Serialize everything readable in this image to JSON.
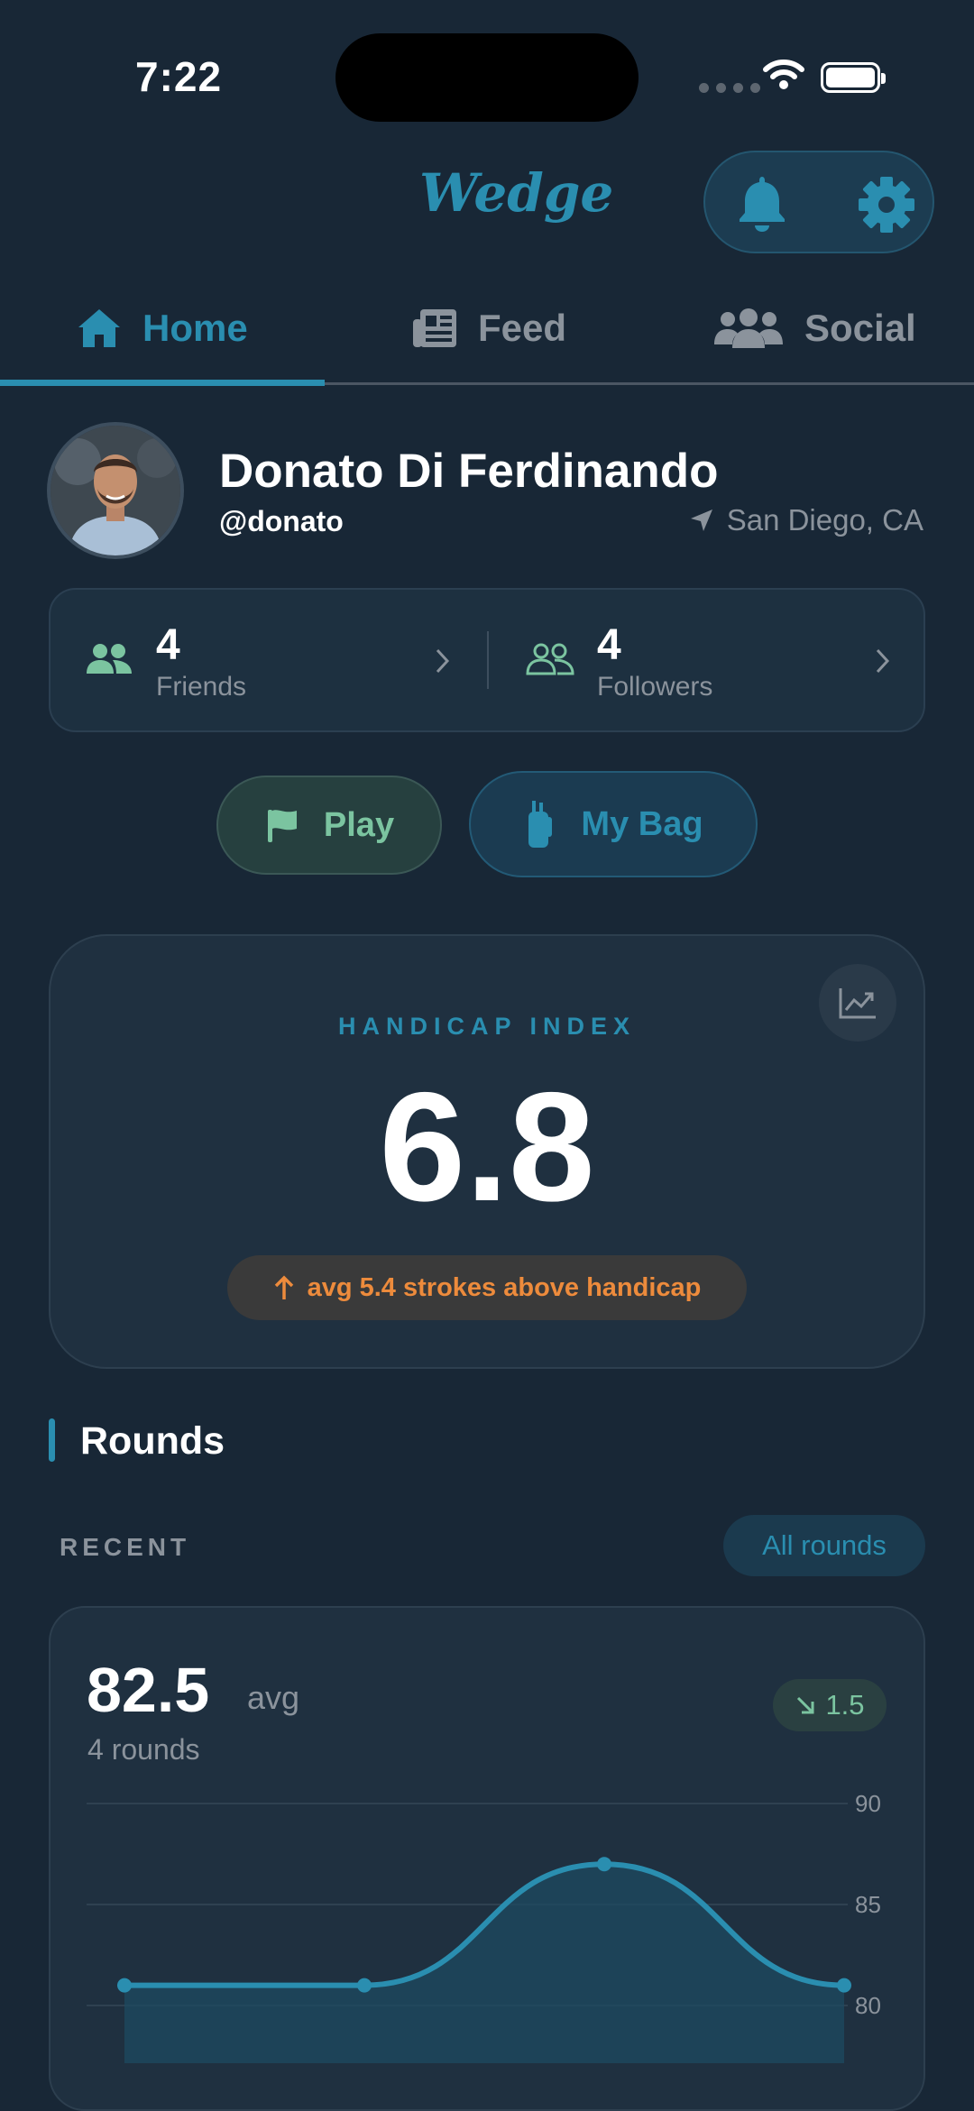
{
  "status_bar": {
    "time": "7:22"
  },
  "header": {
    "logo": "Wedge"
  },
  "tabs": [
    {
      "label": "Home",
      "active": true
    },
    {
      "label": "Feed",
      "active": false
    },
    {
      "label": "Social",
      "active": false
    }
  ],
  "profile": {
    "name": "Donato Di Ferdinando",
    "handle": "@donato",
    "location": "San Diego, CA",
    "friends": {
      "count": "4",
      "label": "Friends"
    },
    "followers": {
      "count": "4",
      "label": "Followers"
    }
  },
  "actions": {
    "play": "Play",
    "bag": "My Bag"
  },
  "handicap": {
    "label": "HANDICAP INDEX",
    "value": "6.8",
    "note": "avg 5.4 strokes above handicap"
  },
  "rounds": {
    "title": "Rounds",
    "recent_label": "RECENT",
    "all_rounds": "All rounds",
    "avg": "82.5",
    "avg_unit": "avg",
    "count_text": "4 rounds",
    "delta": "1.5"
  },
  "colors": {
    "accent": "#2a8eb0",
    "green": "#7bc4a0",
    "orange": "#ed8b3c",
    "background": "#182736"
  },
  "chart_data": {
    "type": "area",
    "x": [
      1,
      2,
      3,
      4
    ],
    "values": [
      81,
      81,
      87,
      81
    ],
    "y_ticks": [
      "90",
      "85",
      "80"
    ],
    "ylim": [
      80,
      90
    ],
    "grid": true
  }
}
